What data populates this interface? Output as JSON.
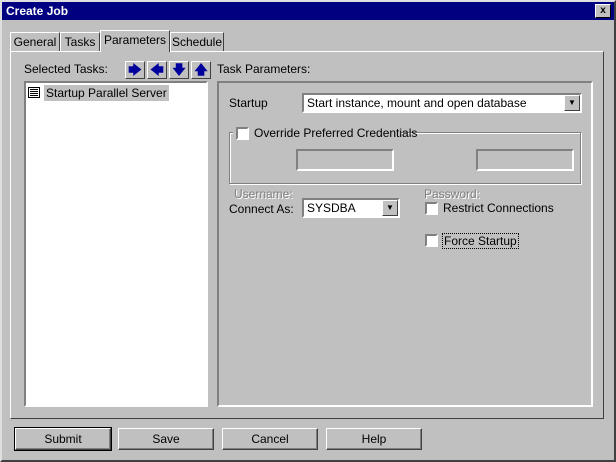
{
  "window": {
    "title": "Create Job",
    "close_glyph": "x"
  },
  "tabs": [
    {
      "label": "General"
    },
    {
      "label": "Tasks"
    },
    {
      "label": "Parameters"
    },
    {
      "label": "Schedule"
    }
  ],
  "selected_tasks": {
    "label": "Selected Tasks:",
    "items": [
      {
        "label": "Startup Parallel Server"
      }
    ],
    "arrow_glyphs": {
      "right": "🡆",
      "left": "🡄",
      "down": "🡇",
      "up": "🡅"
    }
  },
  "task_parameters": {
    "label": "Task Parameters:",
    "startup_label": "Startup",
    "startup_value": "Start instance, mount and open database",
    "override_label": "Override Preferred Credentials",
    "username_label": "Username:",
    "password_label": "Password:",
    "connect_as_label": "Connect As:",
    "connect_as_value": "SYSDBA",
    "restrict_label": "Restrict Connections",
    "force_label": "Force Startup"
  },
  "buttons": {
    "submit": "Submit",
    "save": "Save",
    "cancel": "Cancel",
    "help": "Help"
  }
}
